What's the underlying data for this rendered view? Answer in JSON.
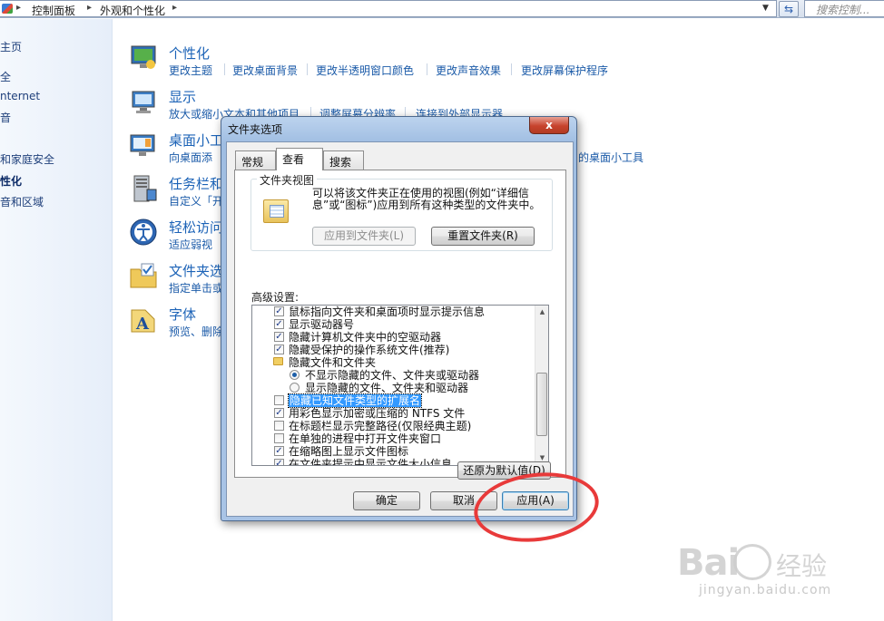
{
  "address_bar": {
    "crumbs": [
      "控制面板",
      "外观和个性化"
    ],
    "search_placeholder": "搜索控制..."
  },
  "left_nav": {
    "items": [
      "主页",
      "全",
      "nternet",
      "音",
      "和家庭安全",
      "性化",
      "音和区域"
    ],
    "active_index": 5
  },
  "categories": [
    {
      "title": "个性化",
      "links": [
        "更改主题",
        "更改桌面背景",
        "更改半透明窗口颜色",
        "更改声音效果",
        "更改屏幕保护程序"
      ]
    },
    {
      "title": "显示",
      "links": [
        "放大或缩小文本和其他项目",
        "调整屏幕分辨率",
        "连接到外部显示器"
      ]
    },
    {
      "title": "桌面小工",
      "links": [
        "向桌面添",
        "的桌面小工具"
      ]
    },
    {
      "title": "任务栏和",
      "links": [
        "自定义「开"
      ]
    },
    {
      "title": "轻松访问",
      "links": [
        "适应弱视"
      ]
    },
    {
      "title": "文件夹选",
      "links": [
        "指定单击或"
      ]
    },
    {
      "title": "字体",
      "links": [
        "预览、删除"
      ]
    }
  ],
  "dialog": {
    "title": "文件夹选项",
    "close_label": "x",
    "tabs": [
      "常规",
      "查看",
      "搜索"
    ],
    "active_tab": 1,
    "folder_views": {
      "label": "文件夹视图",
      "description": "可以将该文件夹正在使用的视图(例如“详细信息”或“图标”)应用到所有这种类型的文件夹中。",
      "apply_button": "应用到文件夹(L)",
      "reset_button": "重置文件夹(R)"
    },
    "advanced_label": "高级设置:",
    "settings": [
      {
        "kind": "check",
        "checked": true,
        "label": "鼠标指向文件夹和桌面项时显示提示信息"
      },
      {
        "kind": "check",
        "checked": true,
        "label": "显示驱动器号"
      },
      {
        "kind": "check",
        "checked": true,
        "label": "隐藏计算机文件夹中的空驱动器"
      },
      {
        "kind": "check",
        "checked": true,
        "label": "隐藏受保护的操作系统文件(推荐)"
      },
      {
        "kind": "folder",
        "label": "隐藏文件和文件夹"
      },
      {
        "kind": "radio",
        "checked": true,
        "label": "不显示隐藏的文件、文件夹或驱动器"
      },
      {
        "kind": "radio",
        "checked": false,
        "label": "显示隐藏的文件、文件夹和驱动器"
      },
      {
        "kind": "check",
        "checked": false,
        "selected": true,
        "label": "隐藏已知文件类型的扩展名"
      },
      {
        "kind": "check",
        "checked": true,
        "label": "用彩色显示加密或压缩的 NTFS 文件"
      },
      {
        "kind": "check",
        "checked": false,
        "label": "在标题栏显示完整路径(仅限经典主题)"
      },
      {
        "kind": "check",
        "checked": false,
        "label": "在单独的进程中打开文件夹窗口"
      },
      {
        "kind": "check",
        "checked": true,
        "label": "在缩略图上显示文件图标"
      },
      {
        "kind": "check",
        "checked": true,
        "label": "在文件夹提示中显示文件大小信息"
      }
    ],
    "restore_defaults": "还原为默认值(D)",
    "ok": "确定",
    "cancel": "取消",
    "apply": "应用(A)"
  },
  "watermark": {
    "logo": "Bai",
    "suffix": "经验",
    "url": "jingyan.baidu.com"
  }
}
